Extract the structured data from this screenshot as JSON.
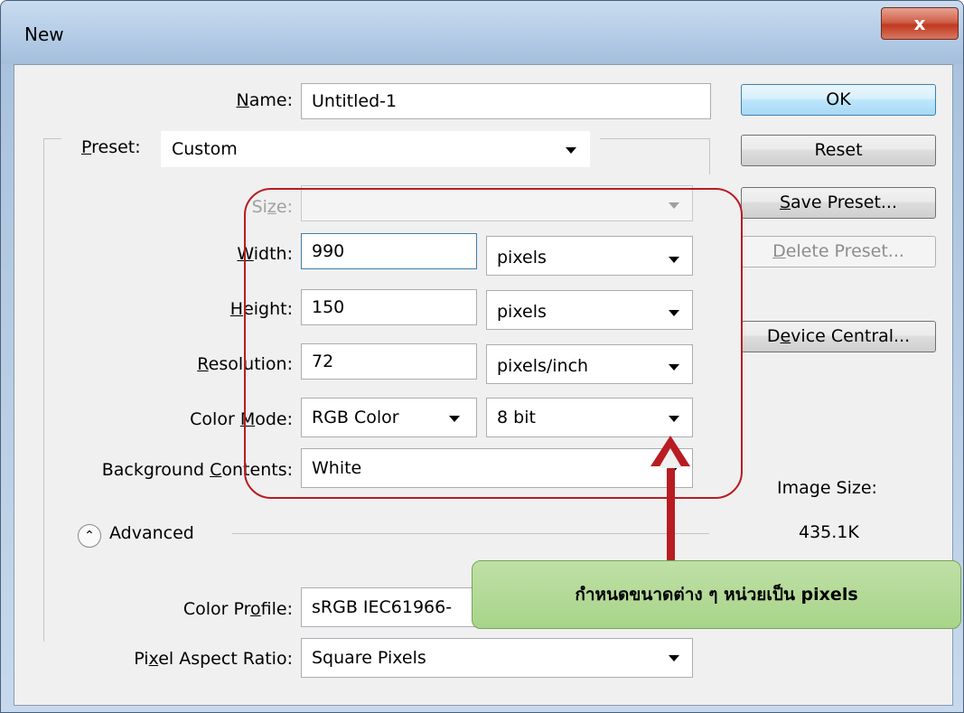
{
  "window": {
    "title": "New",
    "close_label": "x"
  },
  "form": {
    "name": {
      "label_pre": "",
      "label_u": "N",
      "label_post": "ame:",
      "value": "Untitled-1"
    },
    "preset": {
      "label_u": "P",
      "label_post": "reset:",
      "value": "Custom"
    },
    "size": {
      "label_pre": "Si",
      "label_u": "z",
      "label_post": "e:",
      "value": ""
    },
    "width": {
      "label_u": "W",
      "label_post": "idth:",
      "value": "990",
      "unit": "pixels"
    },
    "height": {
      "label_pre": "",
      "label_u": "H",
      "label_post": "eight:",
      "value": "150",
      "unit": "pixels"
    },
    "resolution": {
      "label_u": "R",
      "label_post": "esolution:",
      "value": "72",
      "unit": "pixels/inch"
    },
    "color_mode": {
      "label_pre": "Color ",
      "label_u": "M",
      "label_post": "ode:",
      "value": "RGB Color",
      "depth": "8 bit"
    },
    "background": {
      "label_pre": "Background ",
      "label_u": "C",
      "label_post": "ontents:",
      "value": "White"
    },
    "advanced": {
      "label": "Advanced"
    },
    "color_profile": {
      "label_pre": "Color Pr",
      "label_u": "o",
      "label_post": "file:",
      "value": "sRGB IEC61966-"
    },
    "pixel_aspect": {
      "label_pre": "Pi",
      "label_u": "x",
      "label_post": "el Aspect Ratio:",
      "value": "Square Pixels"
    }
  },
  "buttons": {
    "ok": "OK",
    "reset": "Reset",
    "save_preset_u": "S",
    "save_preset_post": "ave Preset...",
    "delete_preset_u": "D",
    "delete_preset_post": "elete Preset...",
    "device_pre": "D",
    "device_u": "e",
    "device_post": "vice Central..."
  },
  "image_size": {
    "label": "Image Size:",
    "value": "435.1K"
  },
  "annotation": {
    "text": "กำหนดขนาดต่าง ๆ หน่วยเป็น pixels"
  },
  "colors": {
    "annotation_border": "#b81c22",
    "callout_fill": "#a8d48a",
    "window_frame": "#b9d1ea"
  }
}
